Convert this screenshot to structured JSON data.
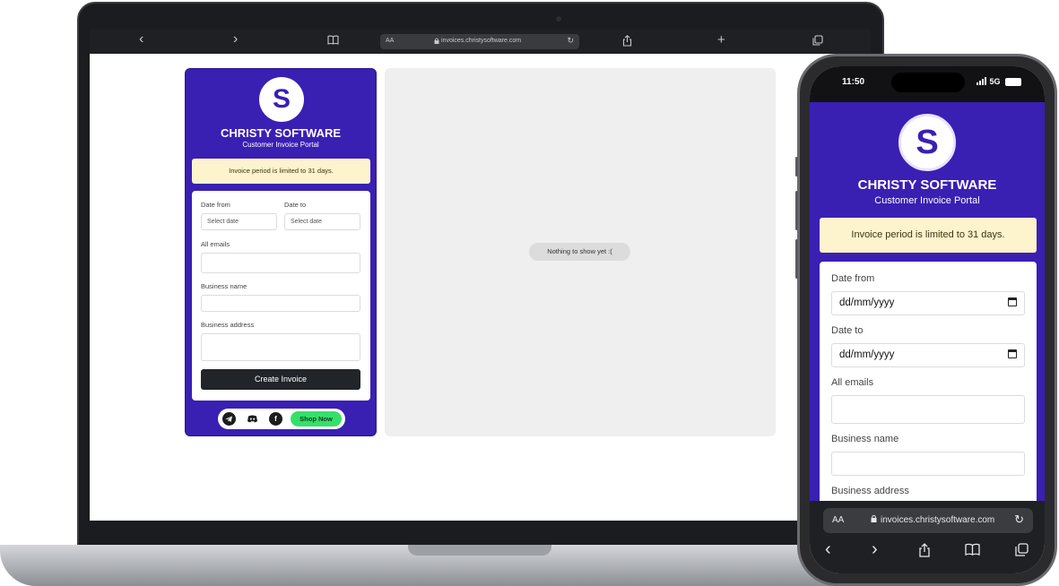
{
  "desktop": {
    "browser": {
      "url": "invoices.christysoftware.com",
      "aa_label": "AA",
      "back_glyph": "‹",
      "forward_glyph": "›",
      "new_tab_glyph": "+",
      "reload_glyph": "↻"
    },
    "app": {
      "logo_letter": "S",
      "brand_name": "CHRISTY SOFTWARE",
      "subtitle": "Customer Invoice Portal",
      "notice": "Invoice period is limited to 31 days.",
      "form": {
        "date_from_label": "Date from",
        "date_from_placeholder": "Select date",
        "date_to_label": "Date to",
        "date_to_placeholder": "Select date",
        "emails_label": "All emails",
        "business_name_label": "Business name",
        "business_address_label": "Business address",
        "submit_label": "Create Invoice"
      },
      "social": {
        "telegram_icon": "telegram-icon",
        "discord_icon": "discord-icon",
        "facebook_icon": "facebook-icon",
        "shop_label": "Shop Now"
      },
      "preview_empty": "Nothing to show yet :("
    }
  },
  "mobile": {
    "status": {
      "time": "11:50",
      "network": "5G"
    },
    "app": {
      "logo_letter": "S",
      "brand_name": "CHRISTY SOFTWARE",
      "subtitle": "Customer Invoice Portal",
      "notice": "Invoice period is limited to 31 days.",
      "form": {
        "date_from_label": "Date from",
        "date_from_value": "dd/mm/yyyy",
        "date_to_label": "Date to",
        "date_to_value": "dd/mm/yyyy",
        "emails_label": "All emails",
        "business_name_label": "Business name",
        "business_address_label": "Business address"
      }
    },
    "browser": {
      "aa_label": "AA",
      "url": "invoices.christysoftware.com",
      "reload_glyph": "↻",
      "back_glyph": "‹",
      "forward_glyph": "›"
    }
  },
  "colors": {
    "brand_purple": "#3a1fb3",
    "notice_bg": "#fdf3cd",
    "shop_green": "#35e06a",
    "button_dark": "#212529"
  }
}
